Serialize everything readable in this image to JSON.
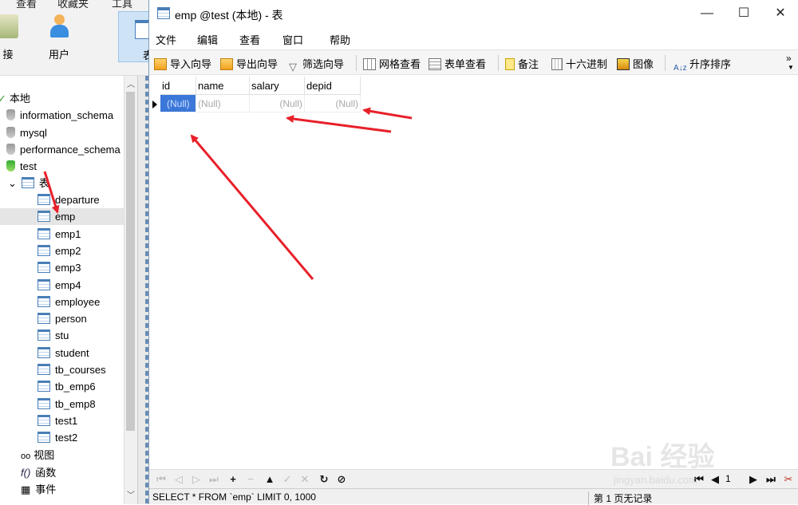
{
  "background_app": {
    "menu": [
      "查看",
      "收藏夹",
      "工具"
    ],
    "tools": [
      {
        "label": "接",
        "icon": "connection-icon"
      },
      {
        "label": "用户",
        "icon": "user-icon"
      },
      {
        "label": "表",
        "icon": "table-icon"
      }
    ],
    "tree": {
      "root": "本地",
      "databases": [
        "information_schema",
        "mysql",
        "performance_schema",
        "test"
      ],
      "tables_label": "表",
      "tables": [
        "departure",
        "emp",
        "emp1",
        "emp2",
        "emp3",
        "emp4",
        "employee",
        "person",
        "stu",
        "student",
        "tb_courses",
        "tb_emp6",
        "tb_emp8",
        "test1",
        "test2"
      ],
      "selected_table": "emp",
      "other_nodes": [
        "视图",
        "函数",
        "事件"
      ]
    }
  },
  "window": {
    "title": "emp @test (本地) - 表",
    "controls": {
      "minimize": "—",
      "maximize": "☐",
      "close": "✕"
    },
    "menu": [
      "文件",
      "编辑",
      "查看",
      "窗口",
      "帮助"
    ],
    "toolbar": [
      {
        "label": "导入向导",
        "icon": "import-wizard-icon"
      },
      {
        "label": "导出向导",
        "icon": "export-wizard-icon"
      },
      {
        "label": "筛选向导",
        "icon": "filter-wizard-icon"
      },
      {
        "label": "网格查看",
        "icon": "grid-view-icon"
      },
      {
        "label": "表单查看",
        "icon": "form-view-icon"
      },
      {
        "label": "备注",
        "icon": "memo-icon"
      },
      {
        "label": "十六进制",
        "icon": "hex-icon"
      },
      {
        "label": "图像",
        "icon": "image-icon"
      },
      {
        "label": "升序排序",
        "icon": "sort-asc-icon"
      }
    ],
    "toolbar_more": "»",
    "grid": {
      "columns": [
        "id",
        "name",
        "salary",
        "depid"
      ],
      "rows": [
        [
          "(Null)",
          "(Null)",
          "(Null)",
          "(Null)"
        ]
      ]
    },
    "status": {
      "sql": "SELECT * FROM `emp` LIMIT 0, 1000",
      "page": "第 1 页无记录"
    },
    "pager": {
      "page_number": "1"
    }
  },
  "annotation_color": "#e8202a",
  "watermark": {
    "brand": "Bai 经验",
    "url": "jingyan.baidu.com"
  }
}
